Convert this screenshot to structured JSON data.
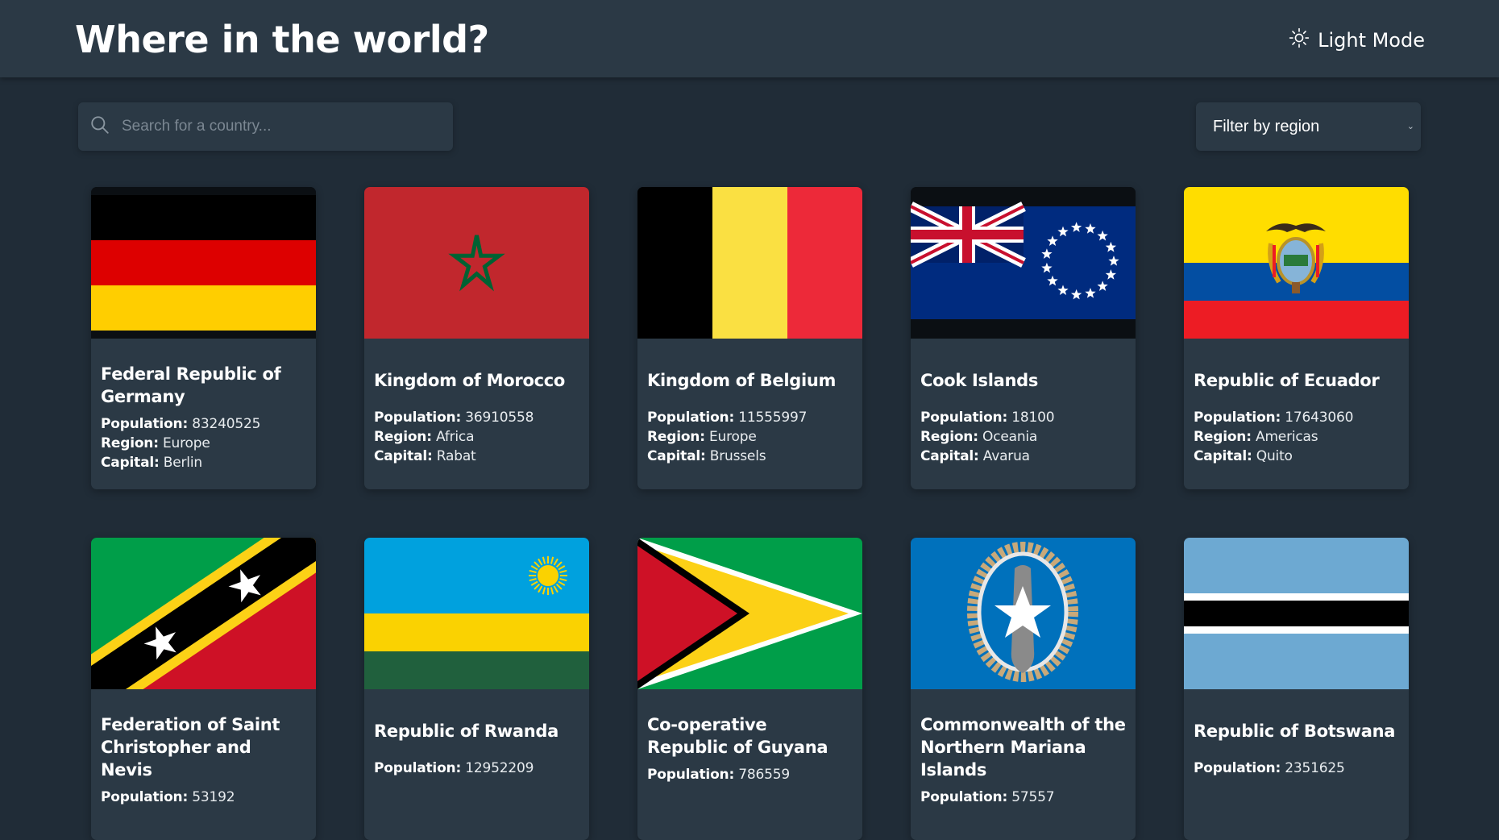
{
  "header": {
    "title": "Where in the world?",
    "mode_label": "Light Mode",
    "mode_icon": "sun-icon"
  },
  "search": {
    "placeholder": "Search for a country...",
    "value": "",
    "icon": "search-icon"
  },
  "filter": {
    "label": "Filter by region",
    "icon": "chevron-down-icon"
  },
  "stat_labels": {
    "population": "Population:",
    "region": "Region:",
    "capital": "Capital:"
  },
  "countries": [
    {
      "name": "Federal Republic of Germany",
      "population": "83240525",
      "region": "Europe",
      "capital": "Berlin",
      "flag": "germany-flag"
    },
    {
      "name": "Kingdom of Morocco",
      "population": "36910558",
      "region": "Africa",
      "capital": "Rabat",
      "flag": "morocco-flag"
    },
    {
      "name": "Kingdom of Belgium",
      "population": "11555997",
      "region": "Europe",
      "capital": "Brussels",
      "flag": "belgium-flag"
    },
    {
      "name": "Cook Islands",
      "population": "18100",
      "region": "Oceania",
      "capital": "Avarua",
      "flag": "cook-islands-flag"
    },
    {
      "name": "Republic of Ecuador",
      "population": "17643060",
      "region": "Americas",
      "capital": "Quito",
      "flag": "ecuador-flag"
    },
    {
      "name": "Federation of Saint Christopher and Nevis",
      "population": "53192",
      "flag": "saint-kitts-and-nevis-flag"
    },
    {
      "name": "Republic of Rwanda",
      "population": "12952209",
      "flag": "rwanda-flag"
    },
    {
      "name": "Co-operative Republic of Guyana",
      "population": "786559",
      "flag": "guyana-flag"
    },
    {
      "name": "Commonwealth of the Northern Mariana Islands",
      "population": "57557",
      "flag": "northern-mariana-islands-flag"
    },
    {
      "name": "Republic of Botswana",
      "population": "2351625",
      "flag": "botswana-flag"
    }
  ],
  "colors": {
    "background": "#202c37",
    "element": "#2b3945",
    "text": "#ffffff",
    "placeholder": "#7b8792"
  }
}
